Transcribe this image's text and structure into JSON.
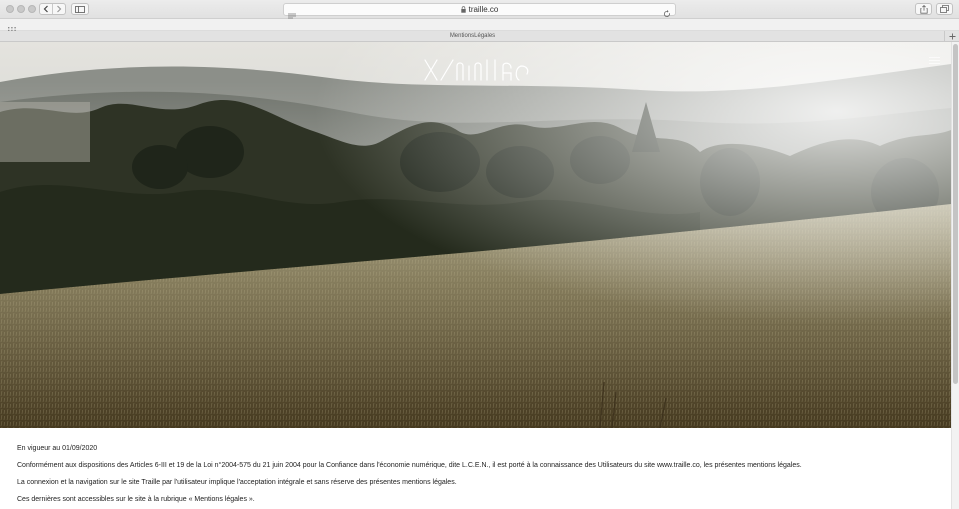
{
  "browser": {
    "url": "traille.co",
    "tab_title": "MentionsLégales",
    "icons": [
      "back-icon",
      "forward-icon",
      "sidebar-icon",
      "menu-lines-icon",
      "lock-icon",
      "reload-icon",
      "share-icon",
      "tabs-overview-icon",
      "grid-icon",
      "plus-icon"
    ]
  },
  "site": {
    "logo_text": "Traille",
    "colors": {
      "logo": "#ffffff",
      "text": "#222222"
    }
  },
  "legal": {
    "effective_date": "En vigueur au 01/09/2020",
    "paragraph_1": "Conformément aux dispositions des Articles 6-III et 19 de la Loi n°2004-575 du 21 juin 2004 pour la Confiance dans l'économie numérique, dite L.C.E.N., il est porté à la connaissance des Utilisateurs du site www.traille.co, les présentes mentions légales.",
    "paragraph_2": "La connexion et la navigation sur le site Traille par l'utilisateur implique l'acceptation intégrale et sans réserve des présentes mentions légales.",
    "paragraph_3": "Ces dernières sont accessibles sur le site à la rubrique « Mentions légales »."
  }
}
